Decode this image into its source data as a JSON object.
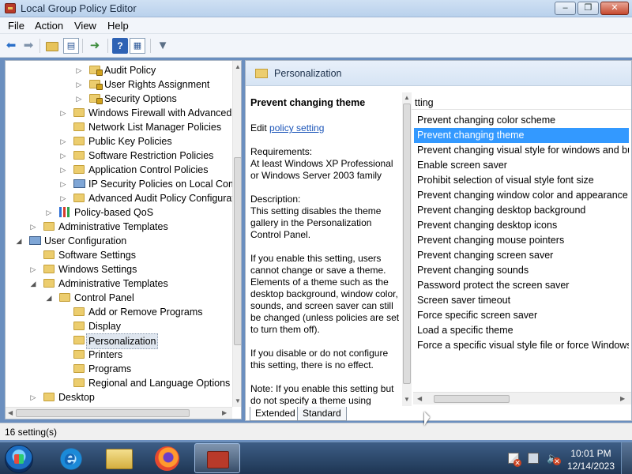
{
  "window": {
    "title": "Local Group Policy Editor",
    "buttons": {
      "minimize": "–",
      "maximize": "❐",
      "close": "✕"
    }
  },
  "menu": [
    "File",
    "Action",
    "View",
    "Help"
  ],
  "toolbar": {
    "icons": [
      "back-arrow-icon",
      "forward-arrow-icon",
      "up-folder-icon",
      "show-hide-tree-icon",
      "export-list-icon",
      "help-icon",
      "properties-icon",
      "filter-icon"
    ],
    "help_label": "?"
  },
  "tree": {
    "items": [
      {
        "label": "Audit Policy",
        "arrow": "▷",
        "icon": "folder-lock"
      },
      {
        "label": "User Rights Assignment",
        "arrow": "▷",
        "icon": "folder-lock"
      },
      {
        "label": "Security Options",
        "arrow": "▷",
        "icon": "folder-lock"
      },
      {
        "label": "Windows Firewall with Advanced S",
        "arrow": "▷",
        "icon": "folder"
      },
      {
        "label": "Network List Manager Policies",
        "arrow": "",
        "icon": "folder"
      },
      {
        "label": "Public Key Policies",
        "arrow": "▷",
        "icon": "folder"
      },
      {
        "label": "Software Restriction Policies",
        "arrow": "▷",
        "icon": "folder"
      },
      {
        "label": "Application Control Policies",
        "arrow": "▷",
        "icon": "folder"
      },
      {
        "label": "IP Security Policies on Local Comp",
        "arrow": "▷",
        "icon": "pc"
      },
      {
        "label": "Advanced Audit Policy Configurati",
        "arrow": "▷",
        "icon": "folder"
      },
      {
        "label": "Policy-based QoS",
        "arrow": "▷",
        "icon": "bars"
      },
      {
        "label": "Administrative Templates",
        "arrow": "▷",
        "icon": "folder"
      },
      {
        "label": "User Configuration",
        "arrow": "◢",
        "icon": "pc"
      },
      {
        "label": "Software Settings",
        "arrow": "",
        "icon": "folder"
      },
      {
        "label": "Windows Settings",
        "arrow": "▷",
        "icon": "folder"
      },
      {
        "label": "Administrative Templates",
        "arrow": "◢",
        "icon": "folder"
      },
      {
        "label": "Control Panel",
        "arrow": "◢",
        "icon": "folder"
      },
      {
        "label": "Add or Remove Programs",
        "arrow": "",
        "icon": "folder"
      },
      {
        "label": "Display",
        "arrow": "",
        "icon": "folder"
      },
      {
        "label": "Personalization",
        "arrow": "",
        "icon": "folder",
        "selected": true
      },
      {
        "label": "Printers",
        "arrow": "",
        "icon": "folder"
      },
      {
        "label": "Programs",
        "arrow": "",
        "icon": "folder"
      },
      {
        "label": "Regional and Language Options",
        "arrow": "",
        "icon": "folder"
      },
      {
        "label": "Desktop",
        "arrow": "▷",
        "icon": "folder"
      }
    ]
  },
  "right": {
    "header_title": "Personalization",
    "description": {
      "title": "Prevent changing theme",
      "edit_prefix": "Edit ",
      "edit_link": "policy setting ",
      "requirements": "Requirements:\nAt least Windows XP Professional or Windows Server 2003 family",
      "description": "Description:\nThis setting disables the theme gallery in the Personalization Control Panel.",
      "enabled_text": "If you enable this setting, users cannot change or save a theme. Elements of a theme such as the desktop background, window color, sounds, and screen saver can still be changed (unless policies are set to turn them off).",
      "disabled_text": "If you disable or do not configure this setting, there is no effect.",
      "note_text": "Note: If you enable this setting but do not specify a theme using"
    },
    "column_header": "tting",
    "settings": [
      "Prevent changing color scheme",
      "Prevent changing theme",
      "Prevent changing visual style for windows and but",
      "Enable screen saver",
      "Prohibit selection of visual style font size",
      "Prevent changing window color and appearance",
      "Prevent changing desktop background",
      "Prevent changing desktop icons",
      "Prevent changing mouse pointers",
      "Prevent changing screen saver",
      "Prevent changing sounds",
      "Password protect the screen saver",
      "Screen saver timeout",
      "Force specific screen saver",
      "Load a specific theme",
      "Force a specific visual style file or force Windows C"
    ],
    "selected_index": 1,
    "tabs": [
      "Extended",
      "Standard"
    ]
  },
  "status": {
    "text": "16 setting(s)"
  },
  "taskbar": {
    "apps": [
      "start-orb",
      "internet-explorer",
      "windows-explorer",
      "firefox",
      "group-policy-editor"
    ],
    "clock_time": "10:01 PM",
    "clock_date": "12/14/2023"
  },
  "colors": {
    "selection": "#3399ff",
    "title_gradient_top": "#cfe0f3",
    "link": "#1a54b8",
    "taskbar": "#2b4a70"
  }
}
